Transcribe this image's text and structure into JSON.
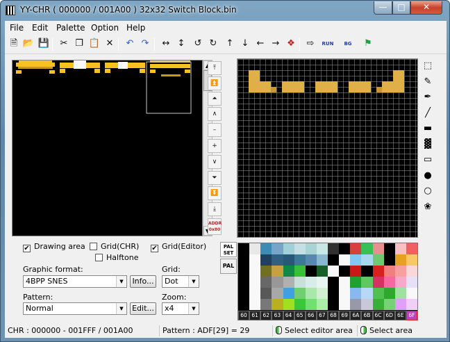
{
  "window": {
    "title": "YY-CHR ( 000000 / 001A00 ) 32x32 Switch Block.bin",
    "minimize": "—",
    "maximize": "□",
    "close": "✕"
  },
  "menu": [
    "File",
    "Edit",
    "Palette",
    "Option",
    "Help"
  ],
  "toolbar": {
    "icons": [
      "new-file",
      "open-folder",
      "save",
      "cut",
      "copy",
      "paste",
      "delete",
      "undo",
      "redo",
      "flip-horizontal",
      "flip-vertical",
      "rotate-left",
      "rotate-right",
      "shift-up",
      "shift-down",
      "shift-left",
      "shift-right",
      "color-replace",
      "export",
      "run",
      "bg-set",
      "exit"
    ],
    "glyphs": [
      "🗎",
      "📂",
      "💾",
      "✂",
      "❐",
      "📋",
      "✕",
      "↶",
      "↷",
      "↔",
      "↕",
      "↺",
      "↻",
      "↑",
      "↓",
      "←",
      "→",
      "❖",
      "⇨",
      "RUN",
      "BG",
      "⚑"
    ]
  },
  "nav": {
    "glyphs": [
      "⤒",
      "⏫",
      "⏶",
      "∧",
      "–",
      "+",
      "∨",
      "⏷",
      "⏬",
      "⤓"
    ],
    "addr_label": "ADDR",
    "addr_value": "0x80"
  },
  "tools": [
    "select-icon",
    "pencil-icon",
    "pen-icon",
    "line-icon",
    "rectangle-fill-icon",
    "pattern-icon",
    "rectangle-icon",
    "circle-fill-icon",
    "circle-icon",
    "fill-bucket-icon"
  ],
  "tool_glyphs": [
    "⬚",
    "✎",
    "✒",
    "╱",
    "▬",
    "▓",
    "▭",
    "●",
    "○",
    "❀"
  ],
  "options": {
    "drawing_area": {
      "label": "Drawing area",
      "checked": true
    },
    "grid_chr": {
      "label": "Grid(CHR)",
      "checked": false
    },
    "grid_editor": {
      "label": "Grid(Editor)",
      "checked": true
    },
    "halftone": {
      "label": "Halftone",
      "checked": false
    },
    "check_mark": "✔",
    "graphic_format_label": "Graphic format:",
    "graphic_format_value": "4BPP SNES",
    "info_button": "Info...",
    "grid_label": "Grid:",
    "grid_value": "Dot",
    "pattern_label": "Pattern:",
    "pattern_value": "Normal",
    "edit_button": "Edit...",
    "zoom_label": "Zoom:",
    "zoom_value": "x4",
    "dropdown_arrow": "▼"
  },
  "palette": {
    "set_label": "PAL SET",
    "tab_label": "PAL",
    "indices": [
      "60",
      "61",
      "62",
      "63",
      "64",
      "65",
      "66",
      "67",
      "68",
      "69",
      "6A",
      "6B",
      "6C",
      "6D",
      "6E",
      "6F"
    ],
    "selected_index": "6F",
    "rows": [
      [
        "#000000",
        "#e8e8e8",
        "#3c8cb4",
        "#78a4c8",
        "#a0d0d8",
        "#c4e0e4",
        "#a8d4d4",
        "#c8e8e8",
        "#303030",
        "#000000",
        "#d84040",
        "#38c058",
        "#e89090",
        "#000000",
        "#f8c0c0",
        "#f06060"
      ],
      [
        "#000000",
        "#f8f8f8",
        "#204060",
        "#306080",
        "#285878",
        "#3c7898",
        "#5888b0",
        "#88b8d0",
        "#000000",
        "#f8f8f8",
        "#80c8f0",
        "#a8d8f0",
        "#70c870",
        "#000000",
        "#e8a020",
        "#f8c868"
      ],
      [
        "#000000",
        "#f8f8f8",
        "#707020",
        "#c8a040",
        "#108848",
        "#38c038",
        "#000000",
        "#186028",
        "#f8f8f8",
        "#000000",
        "#c81818",
        "#000000",
        "#d82020",
        "#f08080",
        "#f8a0a0",
        "#f8d8d8"
      ],
      [
        "#000000",
        "#f8f8f8",
        "#686868",
        "#989898",
        "#b0b0b0",
        "#c8e0d8",
        "#d8ece8",
        "#e8f4f0",
        "#000000",
        "#f8f8f8",
        "#20a030",
        "#60c860",
        "#d83060",
        "#f868a0",
        "#f8a8c8",
        "#e8e0f8"
      ],
      [
        "#000000",
        "#f8f8f8",
        "#585858",
        "#a8a8a8",
        "#40a0e0",
        "#70d070",
        "#a8e8a8",
        "#d0f0d0",
        "#000000",
        "#f8f8f8",
        "#88b8f0",
        "#b8d8f8",
        "#50c050",
        "#30a830",
        "#a0e0a0",
        "#f8f8f8"
      ],
      [
        "#000000",
        "#f8f8f8",
        "#787878",
        "#b8b020",
        "#a0e020",
        "#38c838",
        "#70e070",
        "#a8f0a8",
        "#000000",
        "#f8f8f8",
        "#9898a8",
        "#c8c8d8",
        "#38b038",
        "#78d078",
        "#e0a0f8",
        "#f0d0f8"
      ]
    ]
  },
  "status": {
    "chr_range": "CHR : 000000 - 001FFF / 001A00",
    "pattern": "Pattern : ADF[29] = 29",
    "left_click": "Select editor area",
    "right_click": "Select area"
  },
  "colors": {
    "tile_yellow": "#f8c020",
    "tile_dark_yellow": "#c89818",
    "tile_white": "#f8f8f8",
    "editor_tan": "#e0b048",
    "editor_tan_dark": "#c8963a"
  }
}
